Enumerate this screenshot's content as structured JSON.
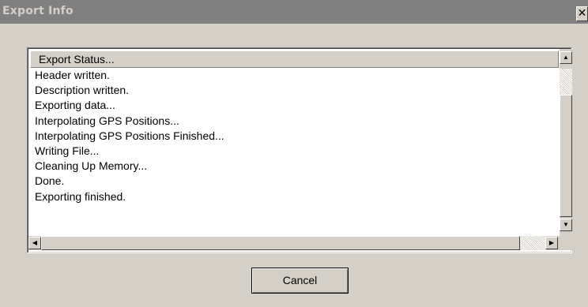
{
  "window": {
    "title": "Export Info",
    "close_glyph": "✕"
  },
  "list": {
    "header": "Export Status...",
    "items": [
      "Header written.",
      "Description written.",
      "Exporting data...",
      "Interpolating GPS Positions...",
      "Interpolating GPS Positions Finished...",
      "Writing File...",
      "Cleaning Up Memory...",
      "Done.",
      "Exporting finished."
    ]
  },
  "scrollbar": {
    "up_glyph": "▲",
    "down_glyph": "▼",
    "left_glyph": "◀",
    "right_glyph": "▶"
  },
  "buttons": {
    "cancel": "Cancel"
  }
}
